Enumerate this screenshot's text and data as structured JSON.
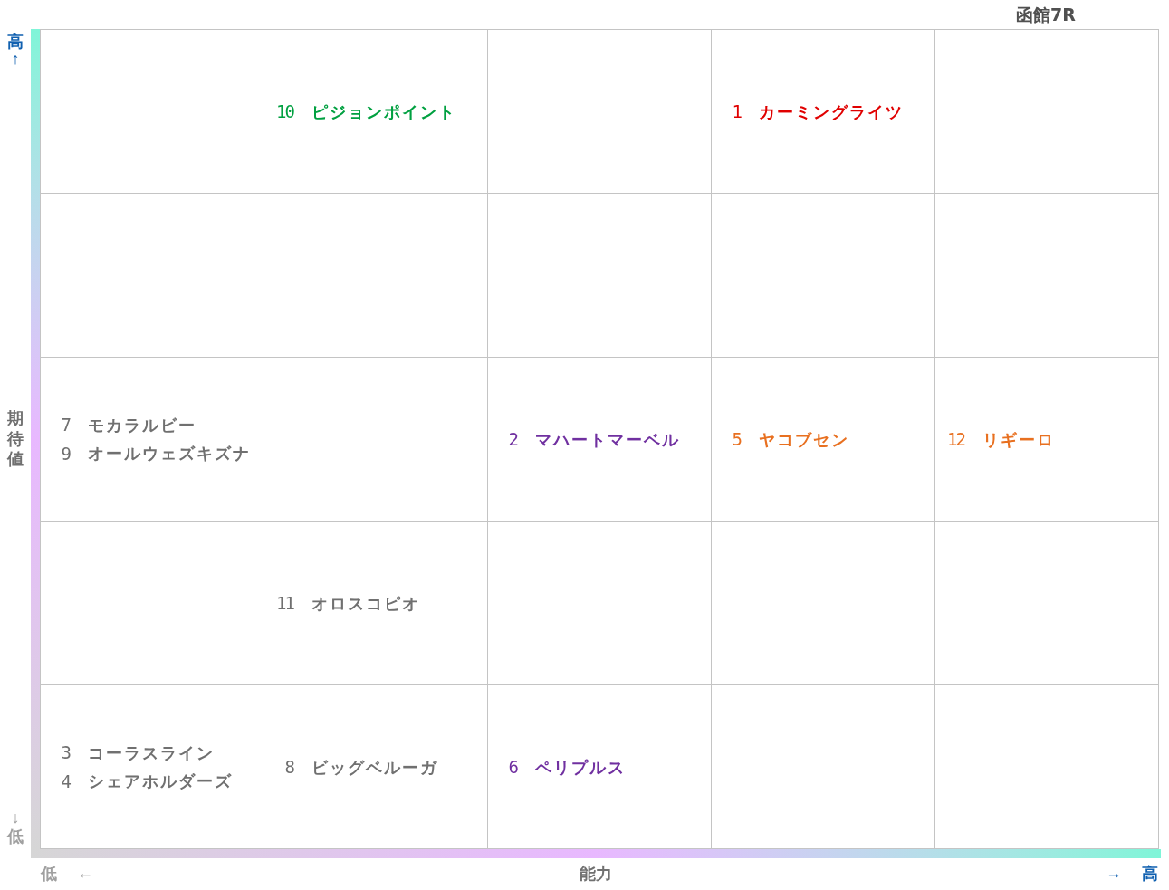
{
  "title": "函館7R",
  "y_axis": {
    "high_label": "高",
    "high_arrow": "↑",
    "label": "期待値",
    "low_arrow": "↓",
    "low_label": "低"
  },
  "x_axis": {
    "low_label": "低",
    "low_arrow": "←",
    "label": "能力",
    "high_arrow": "→",
    "high_label": "高"
  },
  "grid": {
    "rows": [
      {
        "cells": [
          {},
          {
            "entries": [
              {
                "number": "10",
                "name": "ピジョンポイント",
                "color": "#00a040"
              }
            ]
          },
          {},
          {
            "entries": [
              {
                "number": "1",
                "name": "カーミングライツ",
                "color": "#e00000"
              }
            ]
          },
          {}
        ]
      },
      {
        "cells": [
          {},
          {},
          {},
          {},
          {}
        ]
      },
      {
        "cells": [
          {
            "entries": [
              {
                "number": "7",
                "name": "モカラルビー",
                "color": "#707070"
              },
              {
                "number": "9",
                "name": "オールウェズキズナ",
                "color": "#707070"
              }
            ]
          },
          {},
          {
            "entries": [
              {
                "number": "2",
                "name": "マハートマーベル",
                "color": "#7030a0"
              }
            ]
          },
          {
            "entries": [
              {
                "number": "5",
                "name": "ヤコブセン",
                "color": "#e87020"
              }
            ]
          },
          {
            "entries": [
              {
                "number": "12",
                "name": "リギーロ",
                "color": "#e87020"
              }
            ]
          }
        ]
      },
      {
        "cells": [
          {},
          {
            "entries": [
              {
                "number": "11",
                "name": "オロスコピオ",
                "color": "#707070"
              }
            ]
          },
          {},
          {},
          {}
        ]
      },
      {
        "cells": [
          {
            "entries": [
              {
                "number": "3",
                "name": "コーラスライン",
                "color": "#707070"
              },
              {
                "number": "4",
                "name": "シェアホルダーズ",
                "color": "#707070"
              }
            ]
          },
          {
            "entries": [
              {
                "number": "8",
                "name": "ビッグベルーガ",
                "color": "#707070"
              }
            ]
          },
          {
            "entries": [
              {
                "number": "6",
                "name": "ペリプルス",
                "color": "#7030a0"
              }
            ]
          },
          {},
          {}
        ]
      }
    ]
  }
}
